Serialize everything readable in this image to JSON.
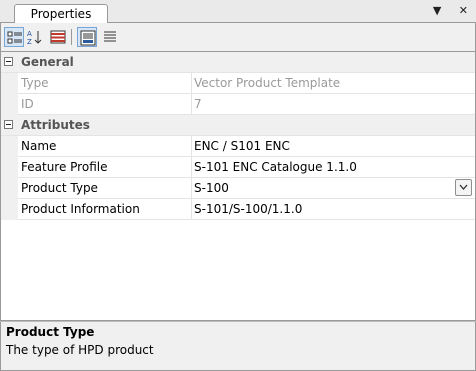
{
  "tab": {
    "label": "Properties"
  },
  "tab_controls": {
    "menu_glyph": "▼",
    "pin_glyph": "✕"
  },
  "toolbar": {
    "buttons": [
      {
        "name": "categorized-icon",
        "active": true
      },
      {
        "name": "alphabetical-icon",
        "active": false
      },
      {
        "name": "property-pages-icon",
        "active": false
      },
      {
        "name": "help-visible-icon",
        "active": true
      },
      {
        "name": "description-icon",
        "active": false
      }
    ]
  },
  "grid": {
    "categories": [
      {
        "label": "General",
        "rows": [
          {
            "name": "Type",
            "value": "Vector Product Template",
            "disabled": true
          },
          {
            "name": "ID",
            "value": "7",
            "disabled": true
          }
        ]
      },
      {
        "label": "Attributes",
        "rows": [
          {
            "name": "Name",
            "value": "ENC / S101 ENC",
            "disabled": false
          },
          {
            "name": "Feature Profile",
            "value": "S-101 ENC Catalogue 1.1.0",
            "disabled": false
          },
          {
            "name": "Product Type",
            "value": "S-100",
            "disabled": false,
            "dropdown": true
          },
          {
            "name": "Product Information",
            "value": "S-101/S-100/1.1.0",
            "disabled": false
          }
        ]
      }
    ]
  },
  "help": {
    "title": "Product Type",
    "description": "The type of HPD product"
  }
}
